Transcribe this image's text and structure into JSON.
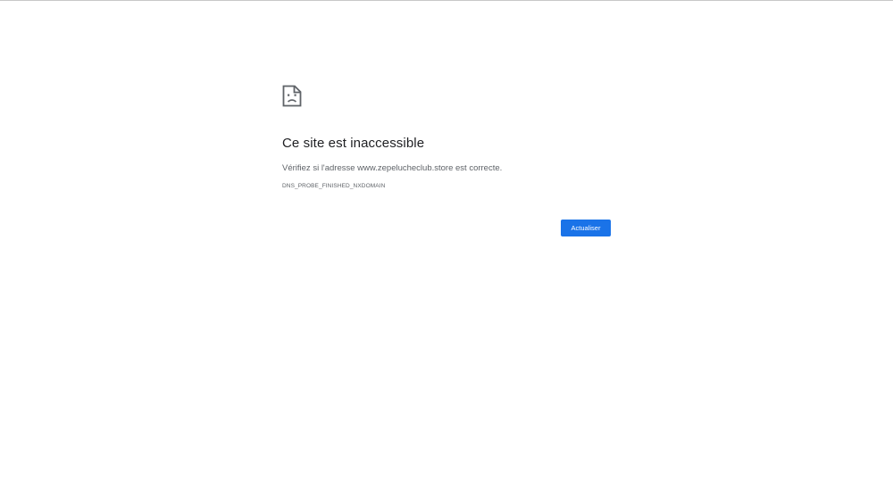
{
  "error_page": {
    "icon": "sad-page-icon",
    "title": "Ce site est inaccessible",
    "message": "Vérifiez si l'adresse www.zepelucheclub.store est correcte.",
    "error_code": "DNS_PROBE_FINISHED_NXDOMAIN",
    "reload_label": "Actualiser"
  },
  "colors": {
    "accent": "#1a73e8",
    "title_text": "#202124",
    "body_text": "#5f6368",
    "background": "#ffffff"
  }
}
